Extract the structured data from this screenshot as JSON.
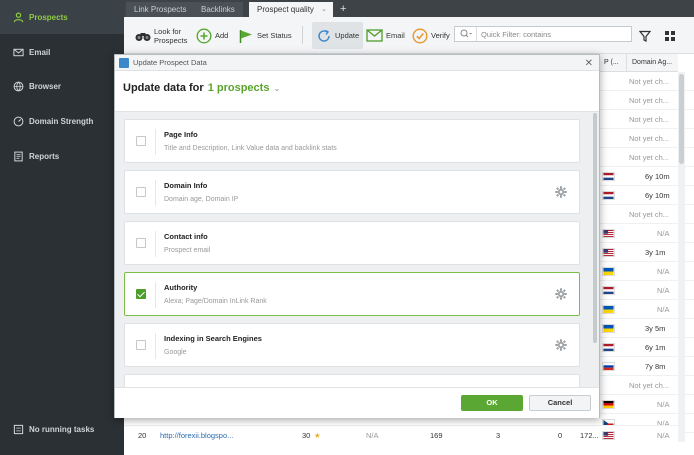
{
  "sidebar": {
    "items": [
      {
        "label": "Prospects",
        "icon": "person-icon"
      },
      {
        "label": "Email",
        "icon": "envelope-icon"
      },
      {
        "label": "Browser",
        "icon": "globe-icon"
      },
      {
        "label": "Domain Strength",
        "icon": "gauge-icon"
      },
      {
        "label": "Reports",
        "icon": "report-icon"
      }
    ],
    "tasks_label": "No running tasks"
  },
  "tabs": [
    {
      "label": "Link Prospects"
    },
    {
      "label": "Backlinks"
    },
    {
      "label": "Prospect quality"
    }
  ],
  "toolbar": {
    "look_for": "Look for",
    "prospects": "Prospects",
    "add": "Add",
    "set_status": "Set Status",
    "update": "Update",
    "email": "Email",
    "verify": "Verify",
    "filter_placeholder": "Quick Filter: contains"
  },
  "grid": {
    "col_headers": [
      "P (...",
      "Domain Ag..."
    ],
    "rows": [
      {
        "age": "Not yet ch...",
        "flag": ""
      },
      {
        "age": "Not yet ch...",
        "flag": ""
      },
      {
        "age": "Not yet ch...",
        "flag": ""
      },
      {
        "age": "Not yet ch...",
        "flag": ""
      },
      {
        "age": "Not yet ch...",
        "flag": ""
      },
      {
        "age": "6y 10m",
        "flag": "nl"
      },
      {
        "age": "6y 10m",
        "flag": "nl"
      },
      {
        "age": "Not yet ch...",
        "flag": ""
      },
      {
        "age": "N/A",
        "flag": "us"
      },
      {
        "age": "3y 1m",
        "flag": "us"
      },
      {
        "age": "N/A",
        "flag": "ua"
      },
      {
        "age": "N/A",
        "flag": "nl"
      },
      {
        "age": "N/A",
        "flag": "ua"
      },
      {
        "age": "3y 5m",
        "flag": "ua"
      },
      {
        "age": "6y 1m",
        "flag": "nl"
      },
      {
        "age": "7y 8m",
        "flag": "ru"
      },
      {
        "age": "Not yet ch...",
        "flag": ""
      },
      {
        "age": "N/A",
        "flag": "de"
      },
      {
        "age": "N/A",
        "flag": "cz"
      }
    ],
    "bottom_row": {
      "num": "20",
      "url": "http://forexii.blogspo...",
      "score": "30",
      "na": "N/A",
      "v1": "169",
      "v2": "3",
      "v3": "0",
      "v4": "172...",
      "age": "N/A"
    }
  },
  "modal": {
    "title": "Update Prospect Data",
    "heading": "Update data for",
    "count": "1 prospects",
    "items": [
      {
        "title": "Page Info",
        "desc": "Title and Description, Link Value data and backlink stats",
        "checked": false,
        "gear": false
      },
      {
        "title": "Domain Info",
        "desc": "Domain age, Domain IP",
        "checked": false,
        "gear": true
      },
      {
        "title": "Contact info",
        "desc": "Prospect email",
        "checked": false,
        "gear": false
      },
      {
        "title": "Authority",
        "desc": "Alexa; Page/Domain InLink Rank",
        "checked": true,
        "gear": true
      },
      {
        "title": "Indexing in Search Engines",
        "desc": "Google",
        "checked": false,
        "gear": true
      }
    ],
    "ok": "OK",
    "cancel": "Cancel"
  },
  "colors": {
    "accent": "#5aa833",
    "sidebar_bg": "#2b3034",
    "active_text": "#8ecb43"
  }
}
